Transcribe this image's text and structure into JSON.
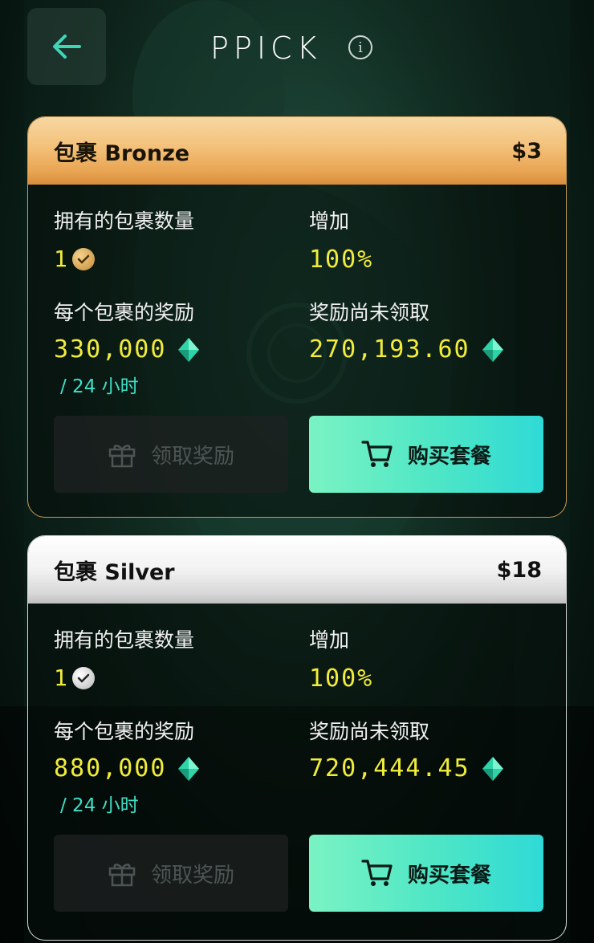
{
  "header": {
    "logo": "PPICK",
    "info_icon": "info-icon",
    "back_icon": "arrow-left-icon"
  },
  "colors": {
    "accent_yellow": "#f2ec3a",
    "accent_teal": "#4de6c6",
    "bronze": "#e9a553",
    "silver": "#d9d9d9"
  },
  "packages": [
    {
      "title": "包裹 Bronze",
      "price": "$3",
      "owned_label": "拥有的包裹数量",
      "owned_value": "1",
      "increase_label": "增加",
      "increase_value": "100%",
      "reward_label": "每个包裹的奖励",
      "reward_value": "330,000",
      "reward_period": "/ 24 小时",
      "unclaimed_label": "奖励尚未领取",
      "unclaimed_value": "270,193.60",
      "claim_label": "领取奖励",
      "buy_label": "购买套餐"
    },
    {
      "title": "包裹 Silver",
      "price": "$18",
      "owned_label": "拥有的包裹数量",
      "owned_value": "1",
      "increase_label": "增加",
      "increase_value": "100%",
      "reward_label": "每个包裹的奖励",
      "reward_value": "880,000",
      "reward_period": "/ 24 小时",
      "unclaimed_label": "奖励尚未领取",
      "unclaimed_value": "720,444.45",
      "claim_label": "领取奖励",
      "buy_label": "购买套餐"
    }
  ]
}
